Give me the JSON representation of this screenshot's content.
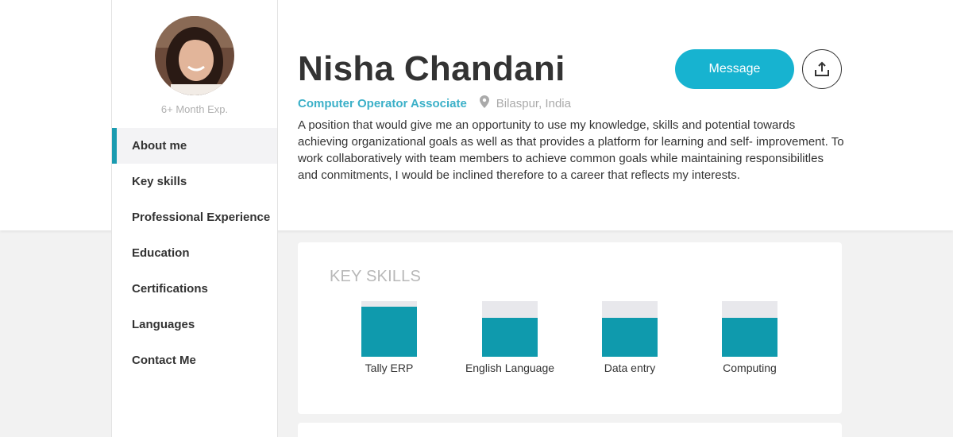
{
  "profile": {
    "name": "Nisha Chandani",
    "experience": "6+ Month Exp.",
    "role": "Computer Operator Associate",
    "location": "Bilaspur, India",
    "bio": "A position that would give me an opportunity to use my knowledge, skills and potential towards achieving organizational goals as well as that provides a platform for learning and self- improvement. To work collaboratively with team members to achieve common goals while maintaining responsibilitles and conmitments, I would be inclined therefore to a career that reflects my interests."
  },
  "actions": {
    "message_label": "Message",
    "share_icon": "share-upload-icon"
  },
  "nav": {
    "items": [
      {
        "label": "About me",
        "active": true
      },
      {
        "label": "Key skills",
        "active": false
      },
      {
        "label": "Professional Experience",
        "active": false
      },
      {
        "label": "Education",
        "active": false
      },
      {
        "label": "Certifications",
        "active": false
      },
      {
        "label": "Languages",
        "active": false
      },
      {
        "label": "Contact Me",
        "active": false
      }
    ]
  },
  "key_skills": {
    "title": "KEY SKILLS",
    "skills": [
      {
        "name": "Tally ERP",
        "level": 0.9
      },
      {
        "name": "English Language",
        "level": 0.7
      },
      {
        "name": "Data entry",
        "level": 0.7
      },
      {
        "name": "Computing",
        "level": 0.7
      }
    ]
  },
  "colors": {
    "accent": "#17b3d0",
    "bar_fill": "#0f9aad",
    "role_text": "#3bb0c8"
  }
}
